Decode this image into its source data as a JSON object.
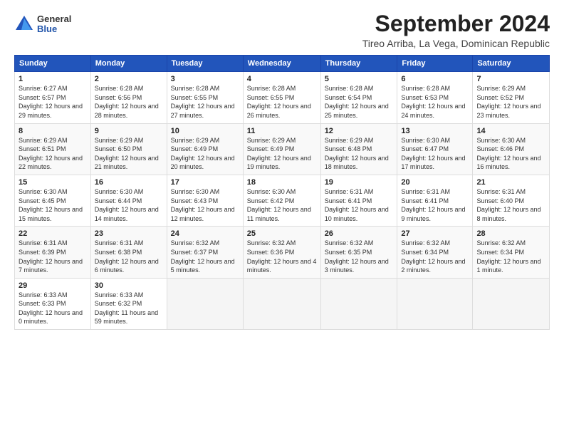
{
  "logo": {
    "general": "General",
    "blue": "Blue"
  },
  "title": "September 2024",
  "subtitle": "Tireo Arriba, La Vega, Dominican Republic",
  "days_header": [
    "Sunday",
    "Monday",
    "Tuesday",
    "Wednesday",
    "Thursday",
    "Friday",
    "Saturday"
  ],
  "weeks": [
    [
      {
        "day": "1",
        "sunrise": "6:27 AM",
        "sunset": "6:57 PM",
        "daylight": "12 hours and 29 minutes."
      },
      {
        "day": "2",
        "sunrise": "6:28 AM",
        "sunset": "6:56 PM",
        "daylight": "12 hours and 28 minutes."
      },
      {
        "day": "3",
        "sunrise": "6:28 AM",
        "sunset": "6:55 PM",
        "daylight": "12 hours and 27 minutes."
      },
      {
        "day": "4",
        "sunrise": "6:28 AM",
        "sunset": "6:55 PM",
        "daylight": "12 hours and 26 minutes."
      },
      {
        "day": "5",
        "sunrise": "6:28 AM",
        "sunset": "6:54 PM",
        "daylight": "12 hours and 25 minutes."
      },
      {
        "day": "6",
        "sunrise": "6:28 AM",
        "sunset": "6:53 PM",
        "daylight": "12 hours and 24 minutes."
      },
      {
        "day": "7",
        "sunrise": "6:29 AM",
        "sunset": "6:52 PM",
        "daylight": "12 hours and 23 minutes."
      }
    ],
    [
      {
        "day": "8",
        "sunrise": "6:29 AM",
        "sunset": "6:51 PM",
        "daylight": "12 hours and 22 minutes."
      },
      {
        "day": "9",
        "sunrise": "6:29 AM",
        "sunset": "6:50 PM",
        "daylight": "12 hours and 21 minutes."
      },
      {
        "day": "10",
        "sunrise": "6:29 AM",
        "sunset": "6:49 PM",
        "daylight": "12 hours and 20 minutes."
      },
      {
        "day": "11",
        "sunrise": "6:29 AM",
        "sunset": "6:49 PM",
        "daylight": "12 hours and 19 minutes."
      },
      {
        "day": "12",
        "sunrise": "6:29 AM",
        "sunset": "6:48 PM",
        "daylight": "12 hours and 18 minutes."
      },
      {
        "day": "13",
        "sunrise": "6:30 AM",
        "sunset": "6:47 PM",
        "daylight": "12 hours and 17 minutes."
      },
      {
        "day": "14",
        "sunrise": "6:30 AM",
        "sunset": "6:46 PM",
        "daylight": "12 hours and 16 minutes."
      }
    ],
    [
      {
        "day": "15",
        "sunrise": "6:30 AM",
        "sunset": "6:45 PM",
        "daylight": "12 hours and 15 minutes."
      },
      {
        "day": "16",
        "sunrise": "6:30 AM",
        "sunset": "6:44 PM",
        "daylight": "12 hours and 14 minutes."
      },
      {
        "day": "17",
        "sunrise": "6:30 AM",
        "sunset": "6:43 PM",
        "daylight": "12 hours and 12 minutes."
      },
      {
        "day": "18",
        "sunrise": "6:30 AM",
        "sunset": "6:42 PM",
        "daylight": "12 hours and 11 minutes."
      },
      {
        "day": "19",
        "sunrise": "6:31 AM",
        "sunset": "6:41 PM",
        "daylight": "12 hours and 10 minutes."
      },
      {
        "day": "20",
        "sunrise": "6:31 AM",
        "sunset": "6:41 PM",
        "daylight": "12 hours and 9 minutes."
      },
      {
        "day": "21",
        "sunrise": "6:31 AM",
        "sunset": "6:40 PM",
        "daylight": "12 hours and 8 minutes."
      }
    ],
    [
      {
        "day": "22",
        "sunrise": "6:31 AM",
        "sunset": "6:39 PM",
        "daylight": "12 hours and 7 minutes."
      },
      {
        "day": "23",
        "sunrise": "6:31 AM",
        "sunset": "6:38 PM",
        "daylight": "12 hours and 6 minutes."
      },
      {
        "day": "24",
        "sunrise": "6:32 AM",
        "sunset": "6:37 PM",
        "daylight": "12 hours and 5 minutes."
      },
      {
        "day": "25",
        "sunrise": "6:32 AM",
        "sunset": "6:36 PM",
        "daylight": "12 hours and 4 minutes."
      },
      {
        "day": "26",
        "sunrise": "6:32 AM",
        "sunset": "6:35 PM",
        "daylight": "12 hours and 3 minutes."
      },
      {
        "day": "27",
        "sunrise": "6:32 AM",
        "sunset": "6:34 PM",
        "daylight": "12 hours and 2 minutes."
      },
      {
        "day": "28",
        "sunrise": "6:32 AM",
        "sunset": "6:34 PM",
        "daylight": "12 hours and 1 minute."
      }
    ],
    [
      {
        "day": "29",
        "sunrise": "6:33 AM",
        "sunset": "6:33 PM",
        "daylight": "12 hours and 0 minutes."
      },
      {
        "day": "30",
        "sunrise": "6:33 AM",
        "sunset": "6:32 PM",
        "daylight": "11 hours and 59 minutes."
      },
      null,
      null,
      null,
      null,
      null
    ]
  ]
}
